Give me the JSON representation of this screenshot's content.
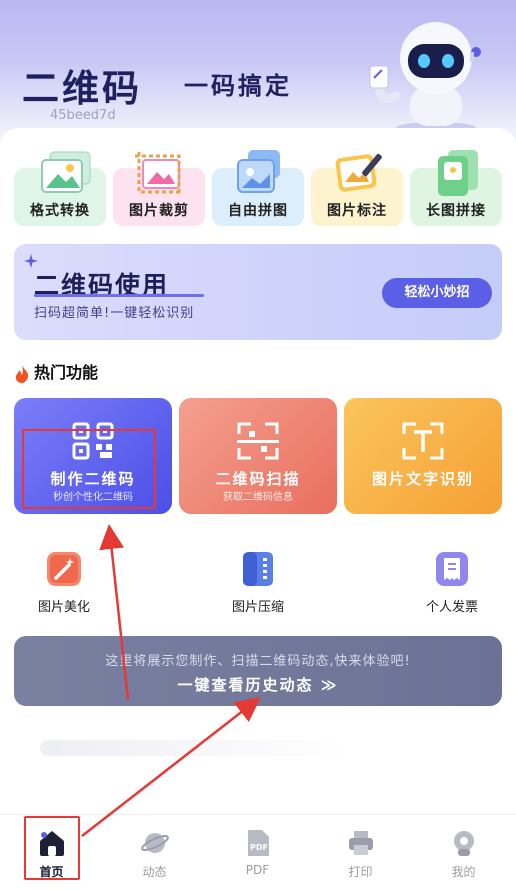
{
  "hero": {
    "title": "二维码",
    "subtitle": "一码搞定",
    "id_text": "45beed7d"
  },
  "tools": [
    {
      "label": "格式转换",
      "color": "#dff5e8",
      "icon": "image-convert-icon"
    },
    {
      "label": "图片裁剪",
      "color": "#fde3ef",
      "icon": "image-crop-icon"
    },
    {
      "label": "自由拼图",
      "color": "#dcedfb",
      "icon": "collage-icon"
    },
    {
      "label": "图片标注",
      "color": "#fdf3cf",
      "icon": "image-annotate-icon"
    },
    {
      "label": "长图拼接",
      "color": "#dff5e2",
      "icon": "long-image-stitch-icon"
    }
  ],
  "banner": {
    "title": "二维码使用",
    "subtitle": "扫码超简单!一键轻松识别",
    "button": "轻松小妙招"
  },
  "section": {
    "title": "热门功能",
    "icon": "flame-icon"
  },
  "features": [
    {
      "title": "制作二维码",
      "subtitle": "秒创个性化二维码",
      "icon": "qr-code-icon",
      "color_from": "#6f72f6",
      "color_to": "#4e52e8"
    },
    {
      "title": "二维码扫描",
      "subtitle": "获取二维码信息",
      "icon": "qr-scan-icon",
      "color_from": "#f39a88",
      "color_to": "#ea6d5d"
    },
    {
      "title": "图片文字识别",
      "subtitle": "",
      "icon": "text-recognition-icon",
      "color_from": "#f9bd55",
      "color_to": "#f5a23a"
    }
  ],
  "mini_tools": [
    {
      "label": "图片美化",
      "icon": "magic-wand-icon",
      "color": "#f0785c"
    },
    {
      "label": "图片压缩",
      "icon": "zip-file-icon",
      "color": "#4a6fe0"
    },
    {
      "label": "个人发票",
      "icon": "invoice-icon",
      "color": "#7b6fe6"
    }
  ],
  "history": {
    "line1": "这里将展示您制作、扫描二维码动态,快来体验吧!",
    "line2": "一键查看历史动态 ≫"
  },
  "tabs": [
    {
      "label": "首页",
      "icon": "home-icon",
      "active": true
    },
    {
      "label": "动态",
      "icon": "planet-icon",
      "active": false
    },
    {
      "label": "PDF",
      "icon": "pdf-icon",
      "active": false
    },
    {
      "label": "打印",
      "icon": "printer-icon",
      "active": false
    },
    {
      "label": "我的",
      "icon": "profile-icon",
      "active": false
    }
  ],
  "colors": {
    "primary": "#5b5fe6",
    "annotation_red": "#e53935",
    "title_navy": "#1e2060"
  }
}
